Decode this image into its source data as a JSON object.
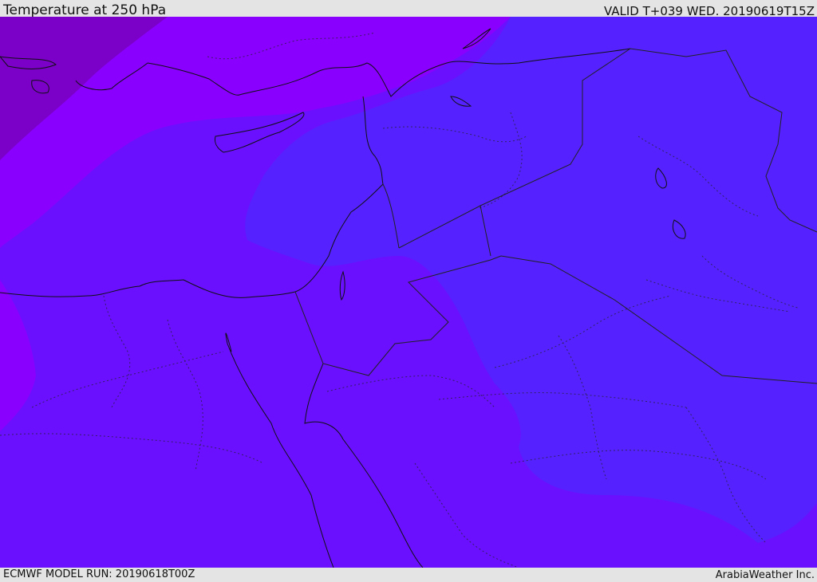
{
  "header": {
    "title": "Temperature at 250 hPa",
    "valid": "VALID T+039 WED. 20190619T15Z"
  },
  "footer": {
    "model_run": "ECMWF MODEL RUN: 20190618T00Z",
    "credit": "ArabiaWeather Inc."
  },
  "colors": {
    "band_coldest": "#7b00c8",
    "band_cold": "#8a00ff",
    "band_mid": "#6a10ff",
    "band_warm": "#5522ff",
    "coastline": "#111111",
    "border": "#222222"
  }
}
